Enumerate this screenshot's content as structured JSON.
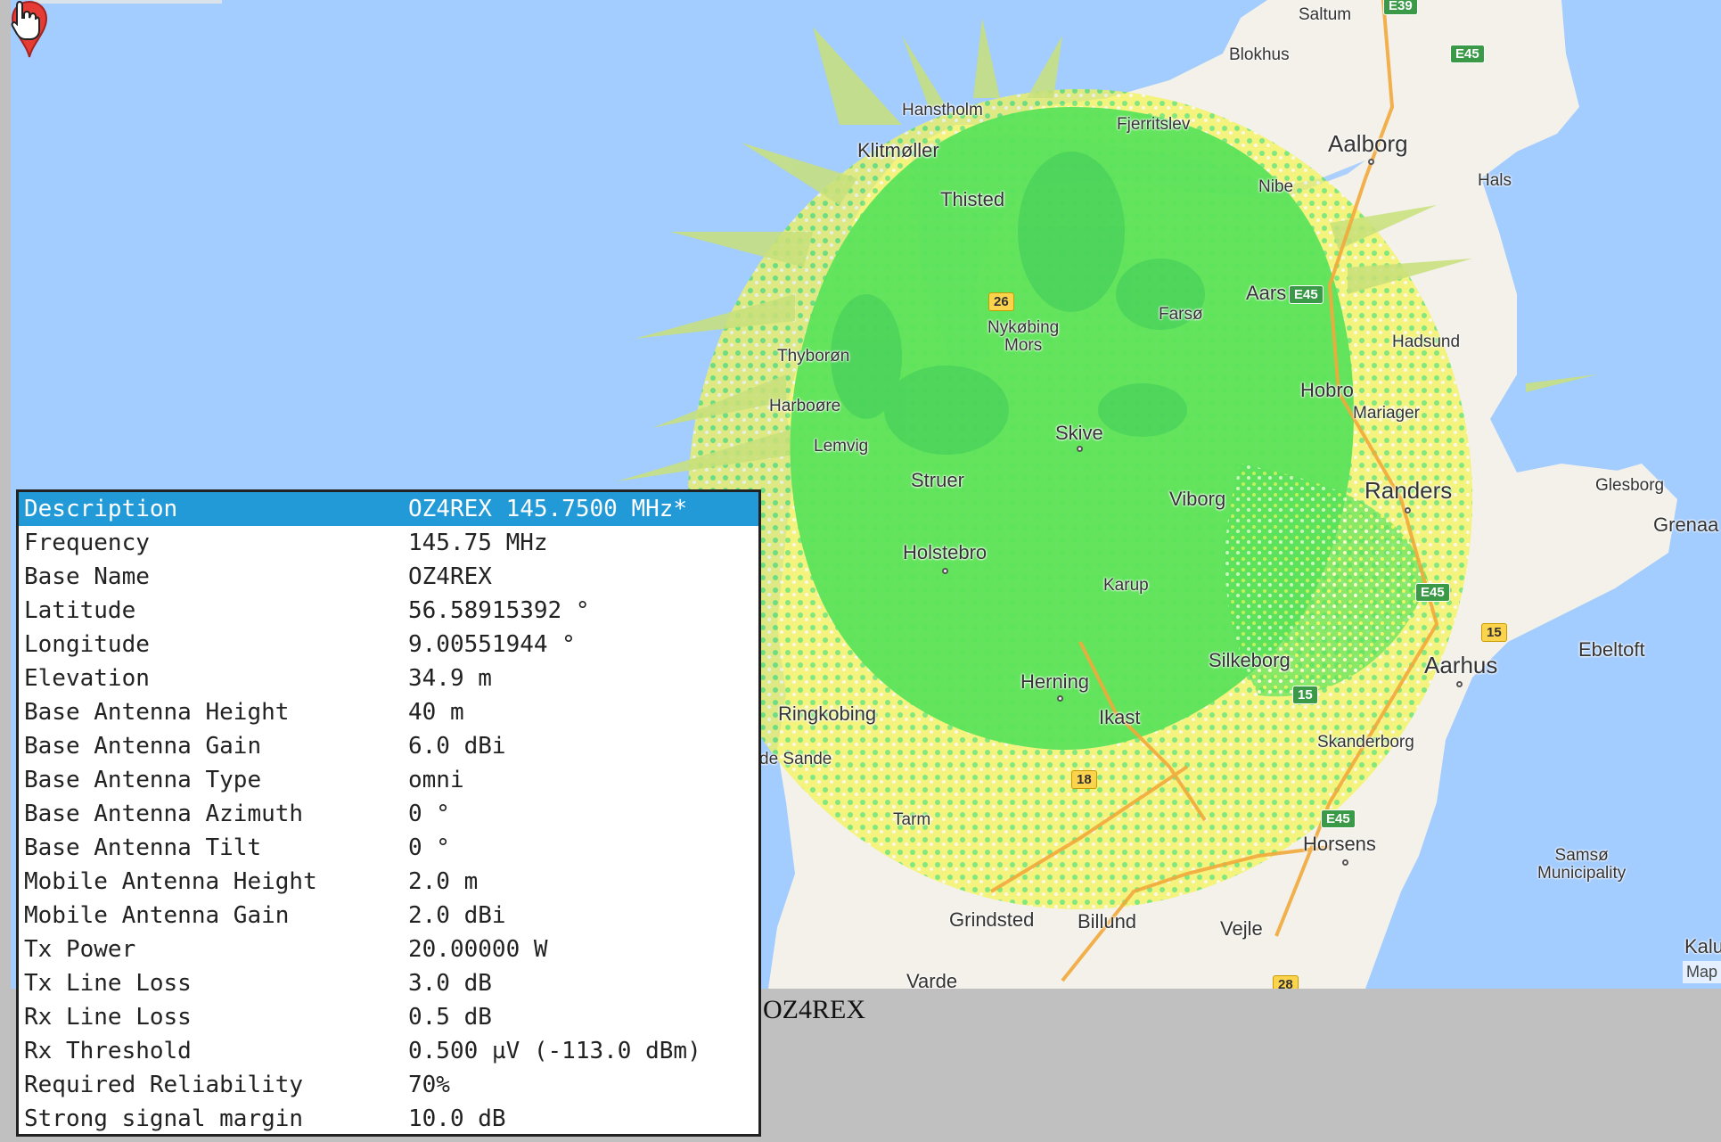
{
  "map": {
    "places": [
      {
        "name": "Saltum",
        "size": "s"
      },
      {
        "name": "Blokhus",
        "size": "s"
      },
      {
        "name": "Hanstholm",
        "size": "s"
      },
      {
        "name": "Fjerritslev",
        "size": "s"
      },
      {
        "name": "Klitmøller",
        "size": "m"
      },
      {
        "name": "Aalborg",
        "size": "l"
      },
      {
        "name": "Nibe",
        "size": "s"
      },
      {
        "name": "Hals",
        "size": "s"
      },
      {
        "name": "Thisted",
        "size": "m"
      },
      {
        "name": "Aars",
        "size": "m"
      },
      {
        "name": "Farsø",
        "size": "s"
      },
      {
        "name": "Nykøbing\nMors",
        "size": "s"
      },
      {
        "name": "Thyborøn",
        "size": "s"
      },
      {
        "name": "Hadsund",
        "size": "s"
      },
      {
        "name": "Hobro",
        "size": "m"
      },
      {
        "name": "Mariager",
        "size": "s"
      },
      {
        "name": "Harboøre",
        "size": "s"
      },
      {
        "name": "Skive",
        "size": "m"
      },
      {
        "name": "Lemvig",
        "size": "s"
      },
      {
        "name": "Struer",
        "size": "m"
      },
      {
        "name": "Viborg",
        "size": "m"
      },
      {
        "name": "Randers",
        "size": "l"
      },
      {
        "name": "Glesborg",
        "size": "s"
      },
      {
        "name": "Grenaa",
        "size": "m"
      },
      {
        "name": "Holstebro",
        "size": "m"
      },
      {
        "name": "Karup",
        "size": "s"
      },
      {
        "name": "Silkeborg",
        "size": "m"
      },
      {
        "name": "Ebeltoft",
        "size": "m"
      },
      {
        "name": "Aarhus",
        "size": "l"
      },
      {
        "name": "Herning",
        "size": "m"
      },
      {
        "name": "Ikast",
        "size": "m"
      },
      {
        "name": "Ringkobing",
        "size": "m"
      },
      {
        "name": "Skanderborg",
        "size": "s"
      },
      {
        "name": "de Sande",
        "size": "s"
      },
      {
        "name": "Tarm",
        "size": "s"
      },
      {
        "name": "Horsens",
        "size": "m"
      },
      {
        "name": "Samsø\nMunicipality",
        "size": "s"
      },
      {
        "name": "Grindsted",
        "size": "m"
      },
      {
        "name": "Billund",
        "size": "m"
      },
      {
        "name": "Vejle",
        "size": "m"
      },
      {
        "name": "Varde",
        "size": "m"
      },
      {
        "name": "Kalu",
        "size": "m"
      }
    ],
    "road_shields": [
      {
        "label": "E39",
        "kind": "e"
      },
      {
        "label": "E45",
        "kind": "e"
      },
      {
        "label": "E45",
        "kind": "e"
      },
      {
        "label": "E45",
        "kind": "e"
      },
      {
        "label": "E45",
        "kind": "e"
      },
      {
        "label": "26",
        "kind": "n"
      },
      {
        "label": "15",
        "kind": "n"
      },
      {
        "label": "15",
        "kind": "e"
      },
      {
        "label": "18",
        "kind": "n"
      },
      {
        "label": "28",
        "kind": "n"
      }
    ],
    "attribution": "Map",
    "coverage_colors": {
      "strong": "#5be35b",
      "weak": "#f3f35a",
      "marginal": "#c8e07a"
    },
    "land_color": "#f3f1ea",
    "water_color": "#a3ccff"
  },
  "info_panel": {
    "rows": [
      {
        "key": "Description",
        "value": "OZ4REX 145.7500 MHz*",
        "highlight": true
      },
      {
        "key": "Frequency",
        "value": "145.75 MHz"
      },
      {
        "key": "Base Name",
        "value": "OZ4REX"
      },
      {
        "key": "Latitude",
        "value": "56.58915392 °"
      },
      {
        "key": "Longitude",
        "value": "9.00551944 °"
      },
      {
        "key": "Elevation",
        "value": "34.9 m"
      },
      {
        "key": "Base Antenna Height",
        "value": "40 m"
      },
      {
        "key": "Base Antenna Gain",
        "value": "6.0 dBi"
      },
      {
        "key": "Base Antenna Type",
        "value": "omni"
      },
      {
        "key": "Base Antenna Azimuth",
        "value": "0 °"
      },
      {
        "key": "Base Antenna Tilt",
        "value": "0 °"
      },
      {
        "key": "Mobile Antenna Height",
        "value": "2.0 m"
      },
      {
        "key": "Mobile Antenna Gain",
        "value": "2.0 dBi"
      },
      {
        "key": "Tx Power",
        "value": "20.00000 W"
      },
      {
        "key": "Tx Line Loss",
        "value": "3.0 dB"
      },
      {
        "key": "Rx Line Loss",
        "value": "0.5 dB"
      },
      {
        "key": "Rx Threshold",
        "value": "0.500 µV (-113.0 dBm)"
      },
      {
        "key": "Required Reliability",
        "value": "70%"
      },
      {
        "key": "Strong signal margin",
        "value": "10.0 dB"
      }
    ]
  },
  "site_label": "OZ4REX"
}
